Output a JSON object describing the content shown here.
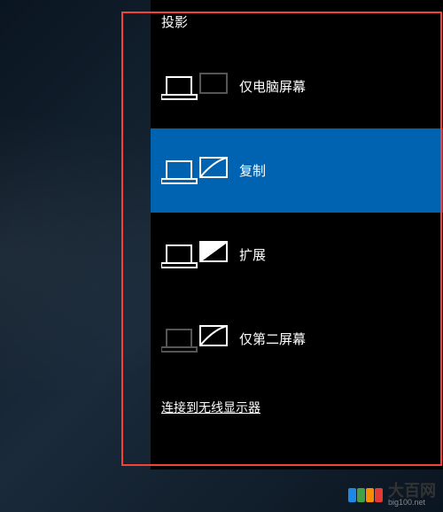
{
  "title": "投影",
  "options": [
    {
      "label": "仅电脑屏幕",
      "icon": "pc-only-icon",
      "selected": false
    },
    {
      "label": "复制",
      "icon": "duplicate-icon",
      "selected": true
    },
    {
      "label": "扩展",
      "icon": "extend-icon",
      "selected": false
    },
    {
      "label": "仅第二屏幕",
      "icon": "second-only-icon",
      "selected": false
    }
  ],
  "connect_link": "连接到无线显示器",
  "watermark": {
    "cn": "大百网",
    "en": "big100.net",
    "colors": [
      "#1e88e5",
      "#43a047",
      "#fb8c00",
      "#e53935"
    ]
  }
}
